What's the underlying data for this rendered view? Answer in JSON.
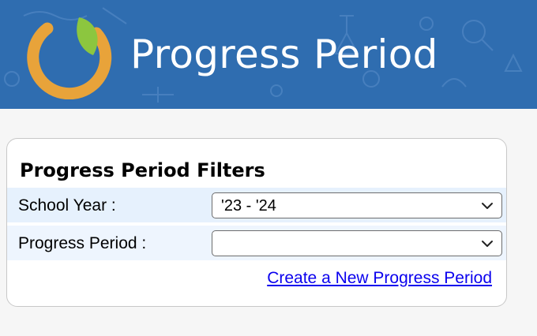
{
  "header": {
    "title": "Progress Period",
    "background_color": "#2f6db0",
    "logo_icon": "leaf-ring-logo-icon"
  },
  "filters": {
    "title": "Progress Period Filters",
    "school_year": {
      "label": "School Year :",
      "value": "'23 - '24",
      "icon": "chevron-down-icon"
    },
    "progress_period": {
      "label": "Progress Period :",
      "value": "",
      "icon": "chevron-down-icon"
    },
    "create_link": "Create a New Progress Period"
  },
  "colors": {
    "link": "#0a00ee",
    "row_highlight": "#e6f1fd",
    "logo_orange": "#e8a33a",
    "logo_green": "#8cc63f"
  }
}
